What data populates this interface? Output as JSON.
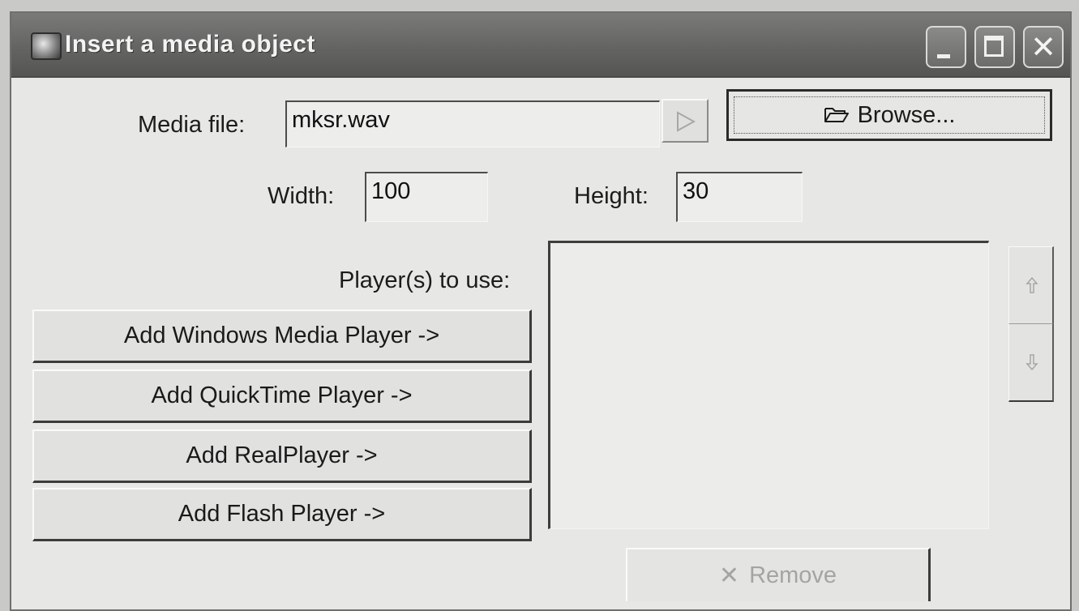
{
  "window": {
    "title": "Insert a media object",
    "icon": "media-app-icon",
    "controls": {
      "minimize_icon": "minimize-icon",
      "maximize_icon": "maximize-icon",
      "close_icon": "close-icon",
      "close_glyph": "✕"
    }
  },
  "media": {
    "file_label": "Media file:",
    "file_value": "mksr.wav",
    "play_icon": "play-icon",
    "browse_label": "Browse...",
    "browse_icon": "folder-open-icon"
  },
  "size": {
    "width_label": "Width:",
    "width_value": "100",
    "height_label": "Height:",
    "height_value": "30"
  },
  "players": {
    "label": "Player(s) to use:",
    "add_buttons": [
      "Add Windows Media Player ->",
      "Add QuickTime Player ->",
      "Add RealPlayer ->",
      "Add Flash Player ->"
    ],
    "list_items": [],
    "move_up_icon": "arrow-up-icon",
    "move_down_icon": "arrow-down-icon",
    "remove_label": "Remove",
    "remove_icon": "remove-x-icon",
    "remove_glyph": "✕"
  }
}
